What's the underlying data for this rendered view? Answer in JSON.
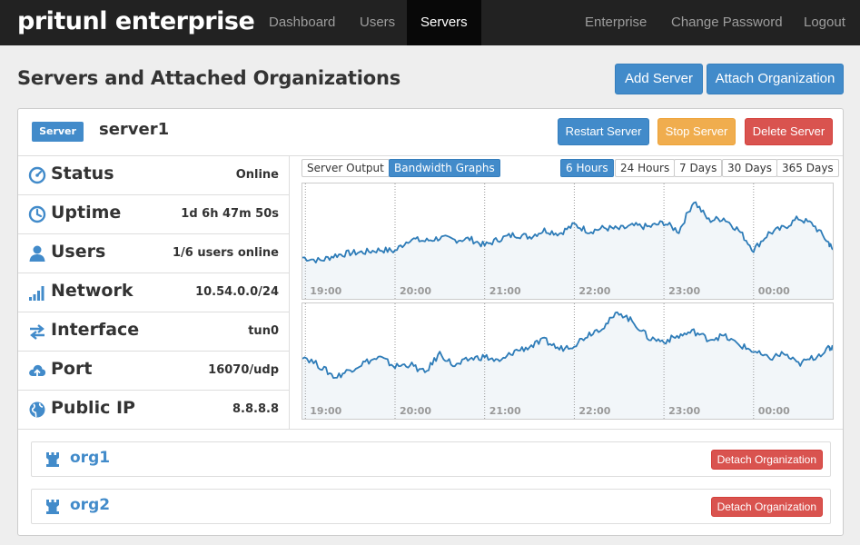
{
  "navbar": {
    "brand": "pritunl enterprise",
    "left_items": [
      "Dashboard",
      "Users",
      "Servers"
    ],
    "active_item": "Servers",
    "right_items": [
      "Enterprise",
      "Change Password",
      "Logout"
    ]
  },
  "page": {
    "title": "Servers and Attached Organizations",
    "add_server_label": "Add Server",
    "attach_org_label": "Attach Organization"
  },
  "server": {
    "badge": "Server",
    "name": "server1",
    "restart_label": "Restart Server",
    "stop_label": "Stop Server",
    "delete_label": "Delete Server",
    "info": [
      {
        "icon": "dashboard-icon",
        "label": "Status",
        "value": "Online"
      },
      {
        "icon": "clock-icon",
        "label": "Uptime",
        "value": "1d 6h 47m 50s"
      },
      {
        "icon": "user-icon",
        "label": "Users",
        "value": "1/6 users online"
      },
      {
        "icon": "signal-icon",
        "label": "Network",
        "value": "10.54.0.0/24"
      },
      {
        "icon": "transfer-icon",
        "label": "Interface",
        "value": "tun0"
      },
      {
        "icon": "cloud-upload-icon",
        "label": "Port",
        "value": "16070/udp"
      },
      {
        "icon": "globe-icon",
        "label": "Public IP",
        "value": "8.8.8.8"
      }
    ],
    "tabs": {
      "output_label": "Server Output",
      "graphs_label": "Bandwidth Graphs",
      "active": "Bandwidth Graphs"
    },
    "periods": [
      "6 Hours",
      "24 Hours",
      "7 Days",
      "30 Days",
      "365 Days"
    ],
    "active_period": "6 Hours"
  },
  "chart_data": [
    {
      "type": "area",
      "x_ticks": [
        "19:00",
        "20:00",
        "21:00",
        "22:00",
        "23:00",
        "00:00"
      ],
      "grid": "vertical dotted",
      "x": [
        "18:58",
        "19:10",
        "19:20",
        "19:30",
        "19:40",
        "19:50",
        "20:00",
        "20:10",
        "20:20",
        "20:30",
        "20:40",
        "20:50",
        "21:00",
        "21:10",
        "21:20",
        "21:30",
        "21:40",
        "21:50",
        "22:00",
        "22:10",
        "22:20",
        "22:30",
        "22:40",
        "22:50",
        "23:00",
        "23:10",
        "23:20",
        "23:30",
        "23:40",
        "23:50",
        "00:00",
        "00:10",
        "00:20",
        "00:30",
        "00:40",
        "00:50",
        "00:53"
      ],
      "values": [
        0.38,
        0.35,
        0.4,
        0.42,
        0.43,
        0.45,
        0.44,
        0.55,
        0.53,
        0.56,
        0.54,
        0.55,
        0.49,
        0.55,
        0.59,
        0.57,
        0.63,
        0.6,
        0.68,
        0.62,
        0.65,
        0.64,
        0.67,
        0.66,
        0.7,
        0.62,
        0.9,
        0.72,
        0.74,
        0.63,
        0.45,
        0.6,
        0.65,
        0.74,
        0.68,
        0.52,
        0.45
      ]
    },
    {
      "type": "area",
      "x_ticks": [
        "19:00",
        "20:00",
        "21:00",
        "22:00",
        "23:00",
        "00:00"
      ],
      "grid": "vertical dotted",
      "x": [
        "18:58",
        "19:10",
        "19:20",
        "19:30",
        "19:40",
        "19:50",
        "20:00",
        "20:10",
        "20:20",
        "20:30",
        "20:40",
        "20:50",
        "21:00",
        "21:10",
        "21:20",
        "21:30",
        "21:40",
        "21:50",
        "22:00",
        "22:10",
        "22:20",
        "22:30",
        "22:40",
        "22:50",
        "23:00",
        "23:10",
        "23:20",
        "23:30",
        "23:40",
        "23:50",
        "00:00",
        "00:10",
        "00:20",
        "00:30",
        "00:40",
        "00:50",
        "00:53"
      ],
      "values": [
        0.58,
        0.48,
        0.38,
        0.45,
        0.52,
        0.56,
        0.48,
        0.5,
        0.42,
        0.6,
        0.48,
        0.55,
        0.57,
        0.52,
        0.62,
        0.66,
        0.72,
        0.64,
        0.68,
        0.78,
        0.85,
        0.98,
        0.88,
        0.74,
        0.71,
        0.76,
        0.8,
        0.73,
        0.76,
        0.68,
        0.62,
        0.55,
        0.6,
        0.5,
        0.56,
        0.64,
        0.66
      ]
    }
  ],
  "organizations": [
    {
      "name": "org1",
      "detach_label": "Detach Organization"
    },
    {
      "name": "org2",
      "detach_label": "Detach Organization"
    }
  ],
  "colors": {
    "navbar_bg": "#222222",
    "primary": "#428bca",
    "warning": "#f0ad4e",
    "danger": "#d9534f",
    "graph_line": "#2e7cb8",
    "graph_fill": "#f2f6f9"
  }
}
